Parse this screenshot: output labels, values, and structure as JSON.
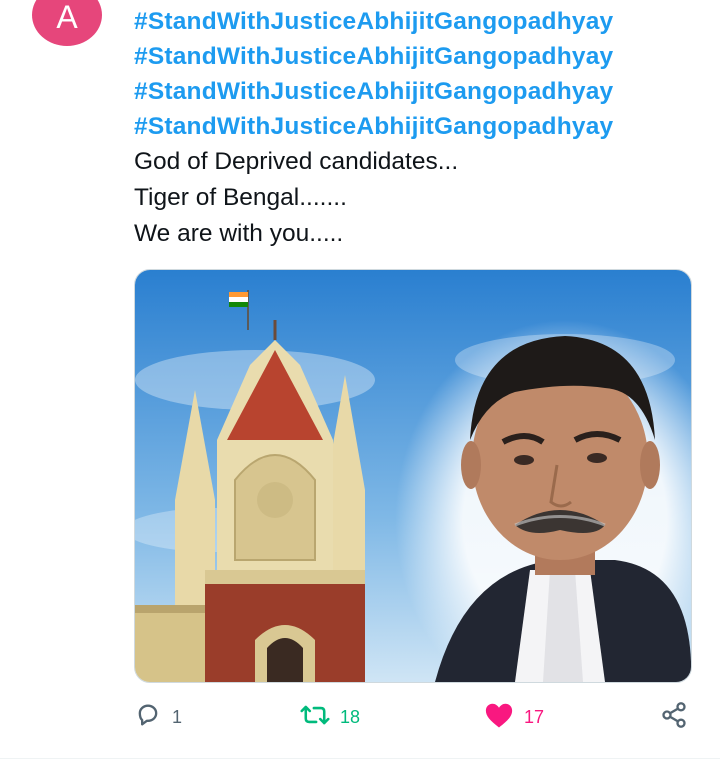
{
  "author": {
    "avatar_letter": "A",
    "avatar_color": "#e6467b"
  },
  "tweet": {
    "hashtags": [
      "#StandWithJusticeAbhijitGangopadhyay",
      "#StandWithJusticeAbhijitGangopadhyay",
      "#StandWithJusticeAbhijitGangopadhyay",
      "#StandWithJusticeAbhijitGangopadhyay"
    ],
    "lines": [
      "God of Deprived candidates...",
      "Tiger of Bengal.......",
      "We are with you....."
    ]
  },
  "media": {},
  "actions": {
    "reply_count": "1",
    "retweet_count": "18",
    "like_count": "17"
  },
  "colors": {
    "link": "#1d9bf0",
    "retweet": "#00ba7c",
    "like": "#f91880",
    "muted": "#536471"
  },
  "icons": [
    "reply-icon",
    "retweet-icon",
    "heart-icon",
    "share-icon"
  ]
}
